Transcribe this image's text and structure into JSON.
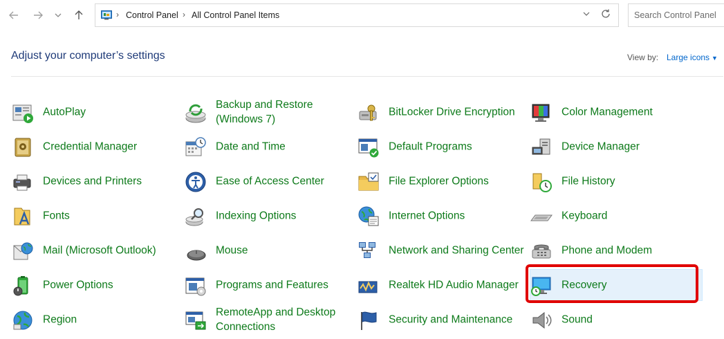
{
  "nav": {
    "back_icon": "back-arrow-icon",
    "forward_icon": "forward-arrow-icon",
    "recent_icon": "chevron-down-icon",
    "up_icon": "up-arrow-icon"
  },
  "address": {
    "crumbs": [
      "Control Panel",
      "All Control Panel Items"
    ]
  },
  "search": {
    "placeholder": "Search Control Panel"
  },
  "header": {
    "title": "Adjust your computer’s settings",
    "view_by_label": "View by:",
    "view_by_value": "Large icons"
  },
  "items": [
    {
      "label": "AutoPlay",
      "icon": "autoplay-icon"
    },
    {
      "label": "Backup and Restore (Windows 7)",
      "icon": "backup-restore-icon"
    },
    {
      "label": "BitLocker Drive Encryption",
      "icon": "bitlocker-icon"
    },
    {
      "label": "Color Management",
      "icon": "color-management-icon"
    },
    {
      "label": "Credential Manager",
      "icon": "credential-manager-icon"
    },
    {
      "label": "Date and Time",
      "icon": "date-time-icon"
    },
    {
      "label": "Default Programs",
      "icon": "default-programs-icon"
    },
    {
      "label": "Device Manager",
      "icon": "device-manager-icon"
    },
    {
      "label": "Devices and Printers",
      "icon": "devices-printers-icon"
    },
    {
      "label": "Ease of Access Center",
      "icon": "ease-of-access-icon"
    },
    {
      "label": "File Explorer Options",
      "icon": "file-explorer-options-icon"
    },
    {
      "label": "File History",
      "icon": "file-history-icon"
    },
    {
      "label": "Fonts",
      "icon": "fonts-icon"
    },
    {
      "label": "Indexing Options",
      "icon": "indexing-options-icon"
    },
    {
      "label": "Internet Options",
      "icon": "internet-options-icon"
    },
    {
      "label": "Keyboard",
      "icon": "keyboard-icon"
    },
    {
      "label": "Mail (Microsoft Outlook)",
      "icon": "mail-icon"
    },
    {
      "label": "Mouse",
      "icon": "mouse-icon"
    },
    {
      "label": "Network and Sharing Center",
      "icon": "network-sharing-icon"
    },
    {
      "label": "Phone and Modem",
      "icon": "phone-modem-icon"
    },
    {
      "label": "Power Options",
      "icon": "power-options-icon"
    },
    {
      "label": "Programs and Features",
      "icon": "programs-features-icon"
    },
    {
      "label": "Realtek HD Audio Manager",
      "icon": "realtek-audio-icon"
    },
    {
      "label": "Recovery",
      "icon": "recovery-icon",
      "selected": true
    },
    {
      "label": "Region",
      "icon": "region-icon"
    },
    {
      "label": "RemoteApp and Desktop Connections",
      "icon": "remoteapp-icon"
    },
    {
      "label": "Security and Maintenance",
      "icon": "security-maintenance-icon"
    },
    {
      "label": "Sound",
      "icon": "sound-icon"
    }
  ],
  "colors": {
    "item_link": "#0d7a1a",
    "title": "#1e3a78",
    "highlight": "#e00000",
    "selected_bg": "#e5f1fb"
  }
}
